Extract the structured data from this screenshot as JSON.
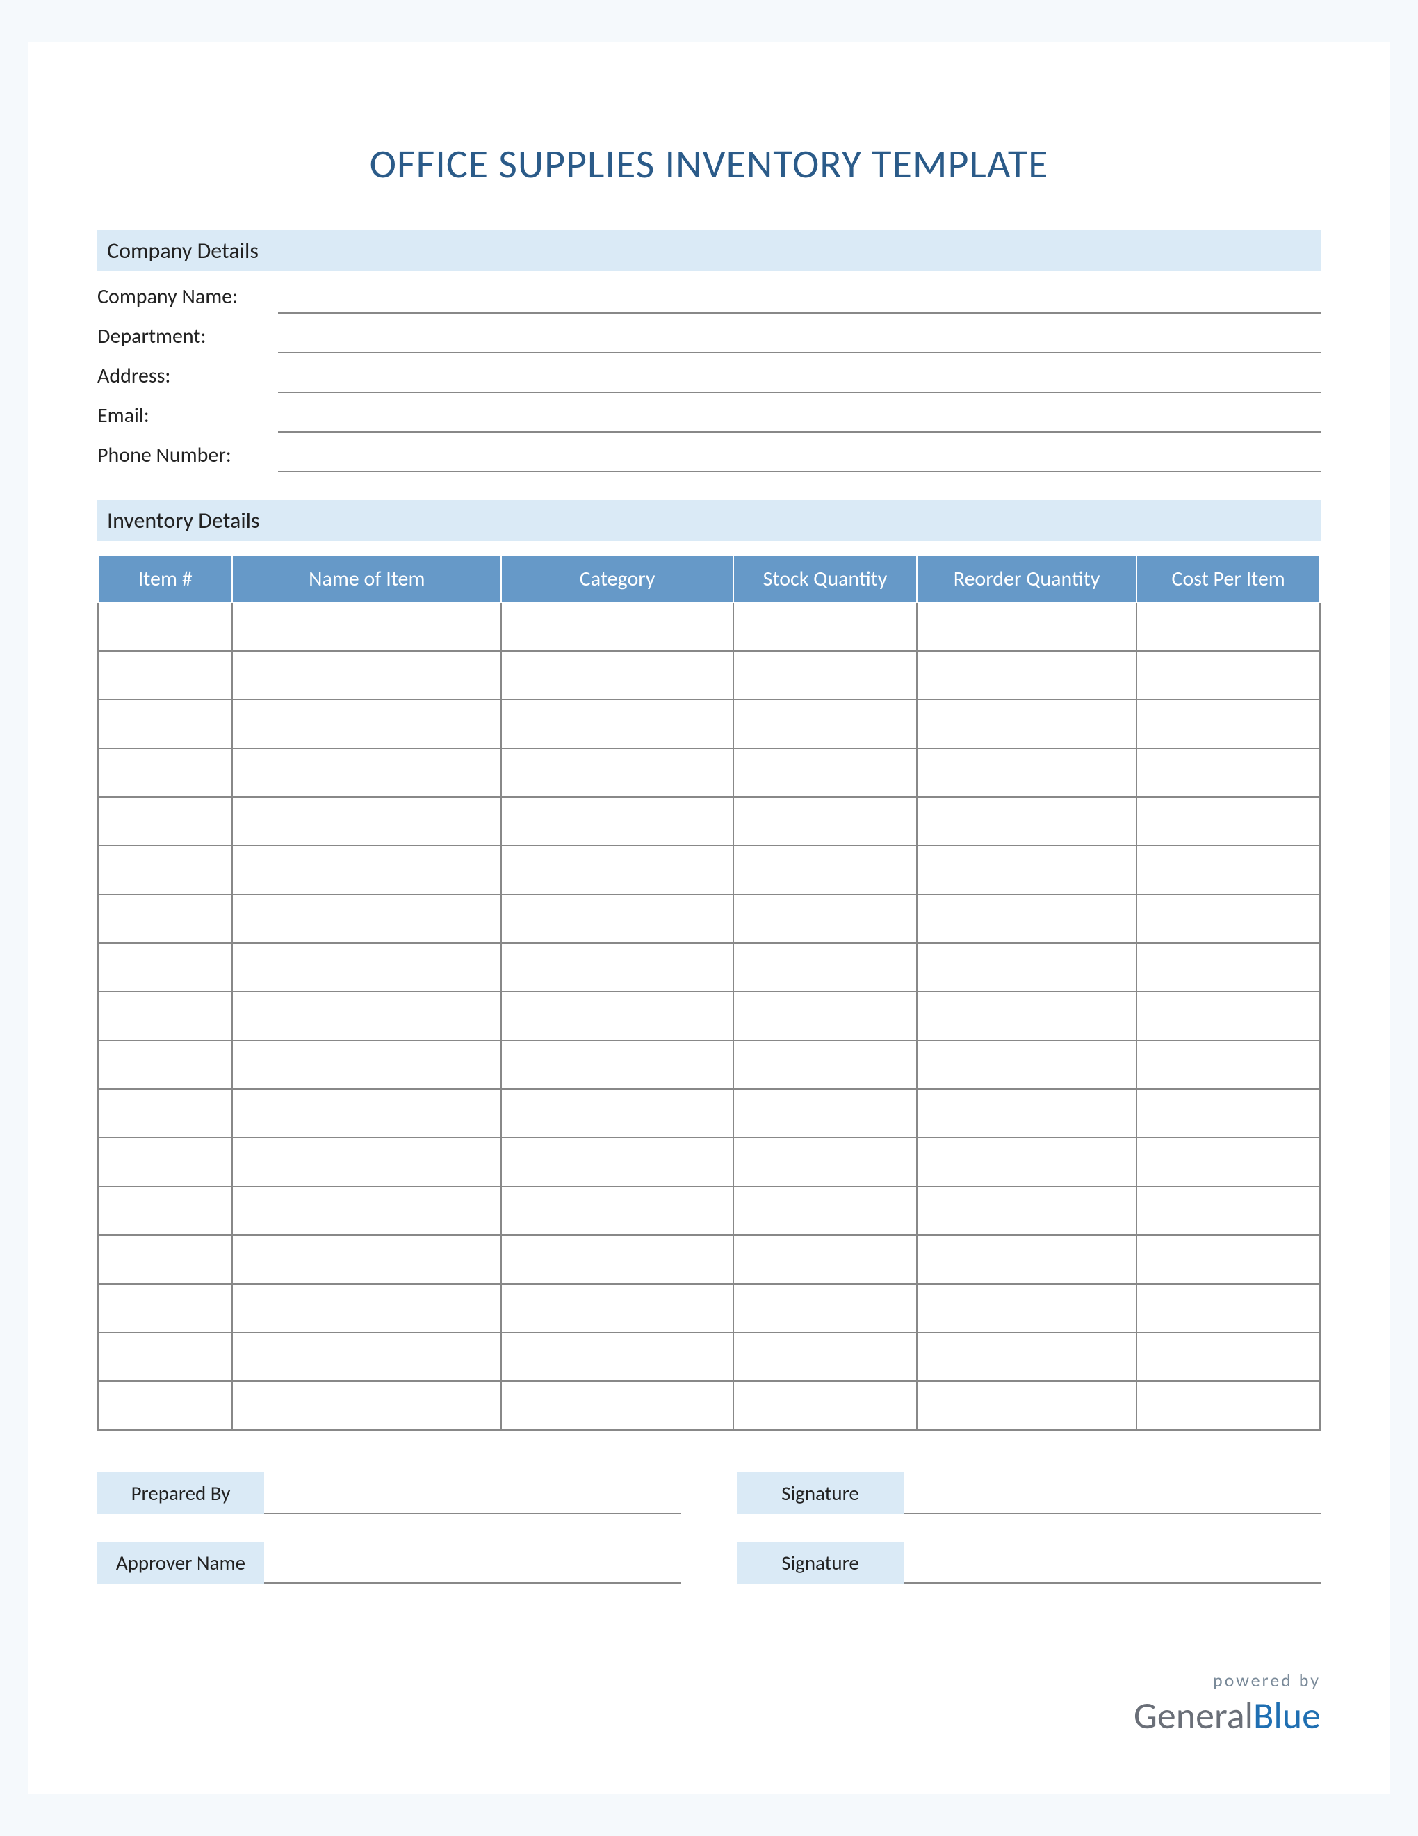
{
  "title": "OFFICE SUPPLIES INVENTORY TEMPLATE",
  "sections": {
    "company": {
      "header": "Company Details",
      "fields": [
        {
          "label": "Company Name:",
          "value": ""
        },
        {
          "label": "Department:",
          "value": ""
        },
        {
          "label": "Address:",
          "value": ""
        },
        {
          "label": "Email:",
          "value": ""
        },
        {
          "label": "Phone Number:",
          "value": ""
        }
      ]
    },
    "inventory": {
      "header": "Inventory Details",
      "columns": [
        "Item #",
        "Name of Item",
        "Category",
        "Stock Quantity",
        "Reorder Quantity",
        "Cost Per Item"
      ],
      "row_count": 17
    }
  },
  "signoff": {
    "row1": {
      "left": "Prepared By",
      "right": "Signature"
    },
    "row2": {
      "left": "Approver Name",
      "right": "Signature"
    }
  },
  "footer": {
    "powered": "powered by",
    "brand_general": "General",
    "brand_blue": "Blue"
  }
}
